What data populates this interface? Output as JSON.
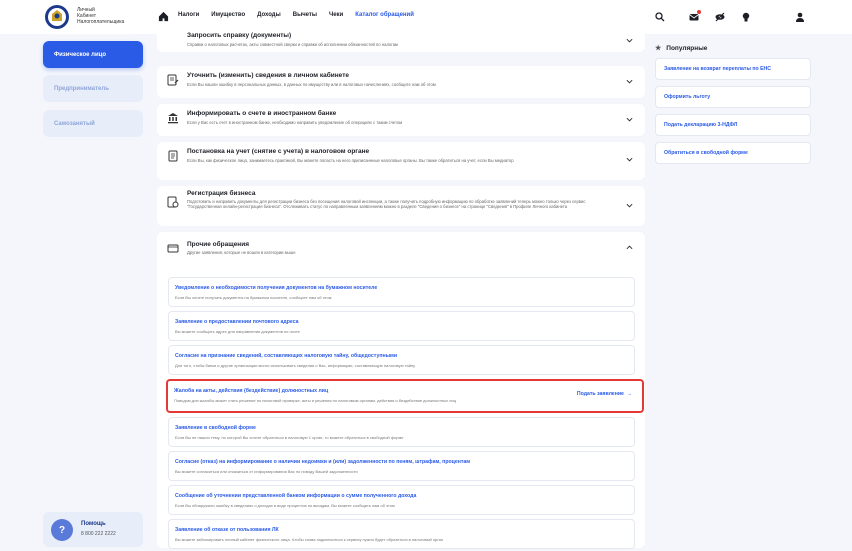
{
  "header": {
    "brand_lines": [
      "Личный",
      "Кабинет",
      "Налогоплательщика"
    ],
    "nav": [
      "Налоги",
      "Имущество",
      "Доходы",
      "Вычеты",
      "Чеки",
      "Каталог обращений"
    ],
    "active_nav_index": 5
  },
  "sidebar": {
    "items": [
      "Физическое лицо",
      "Предприниматель",
      "Самозанятый"
    ],
    "active_index": 0,
    "help_title": "Помощь",
    "help_phone": "8 800 222 2222"
  },
  "cards": [
    {
      "title": "Запросить справку (документы)",
      "desc": "Справки о налоговых расчетах, акты совместной сверки и справки об исполнении обязанностей по налогам"
    },
    {
      "title": "Уточнить (изменить) сведения в личном кабинете",
      "desc": "Если Вы нашли ошибку в персональных данных, в данных по имуществу или в налоговых начислениях, сообщите нам об этом"
    },
    {
      "title": "Информировать о счете в иностранном банке",
      "desc": "Если у Вас есть счет в иностранном банке, необходимо направить уведомление об операциях с таким счетом"
    },
    {
      "title": "Постановка на учет (снятие с учета) в налоговом органе",
      "desc": "Если Вы, как физическое лицо, занимаетесь практикой, Вы можете попасть на него приписаннные налоговые органы. Вы также обратиться на учет, если Вы медиатор"
    },
    {
      "title": "Регистрация бизнеса",
      "desc": "Подготовить и направить документы для регистрации бизнеса без посещения налоговой инспекции, а также получить подробную информацию по обработке заявлений теперь можно только через сервис \"Государственная онлайн-регистрация бизнеса\". Отслеживать статус по направленным заявлениям можно в разделе \"Сведения о бизнесе\" на странице \"Сведения\" в Профиле Личного кабинета"
    }
  ],
  "other": {
    "title": "Прочие обращения",
    "desc": "Другие заявления, которые не вошли в категории выше",
    "items": [
      {
        "title": "Уведомление о необходимости получения документов на бумажном носителе",
        "desc": "Если Вы хотите получать документы на бумажном носителе, сообщите нам об этом"
      },
      {
        "title": "Заявление о предоставлении почтового адреса",
        "desc": "Вы можете сообщить адрес для направления документов по почте"
      },
      {
        "title": "Согласие на признание сведений, составляющих налоговую тайну, общедоступными",
        "desc": "Для того, чтобы банки и другие организации могли использовать сведения о Вас, информацию, составляющую налоговую тайну"
      },
      {
        "title": "Жалоба на акты, действия (бездействие) должностных лиц",
        "desc": "Поводом для жалобы может стать решение по налоговой проверке, акты и решения по налоговым органам, действия и бездействие должностных лиц",
        "action": "Подать заявление"
      },
      {
        "title": "Заявление в свободной форме",
        "desc": "Если Вы не нашли тему, по которой Вы хотите обратиться в налоговую 1 орган, то можете обратиться в свободной форме"
      },
      {
        "title": "Согласие (отказ) на информирование о наличии недоимки и (или) задолженности по пеням, штрафам, процентам",
        "desc": "Вы можете согласиться или отказаться от информирования Вас по поводу Вашей задолженности"
      },
      {
        "title": "Сообщение об уточнении представленной банком информации о сумме полученного дохода",
        "desc": "Если Вы обнаружили ошибку в сведениях о доходах в виде процентов по вкладам, Вы можете сообщить нам об этом"
      },
      {
        "title": "Заявление об отказе от пользования ЛК",
        "desc": "Вы можете заблокировать личный кабинет физического лица. Чтобы снова подключиться к сервису нужно будет обратиться в налоговый орган"
      }
    ],
    "highlight_index": 3
  },
  "popular": {
    "title": "Популярные",
    "items": [
      "Заявление на возврат переплаты по ЕНС",
      "Оформить льготу",
      "Подать декларацию 3-НДФЛ",
      "Обратиться в свободной форме"
    ]
  },
  "colors": {
    "accent": "#2a5be6",
    "highlight": "#e53935"
  }
}
